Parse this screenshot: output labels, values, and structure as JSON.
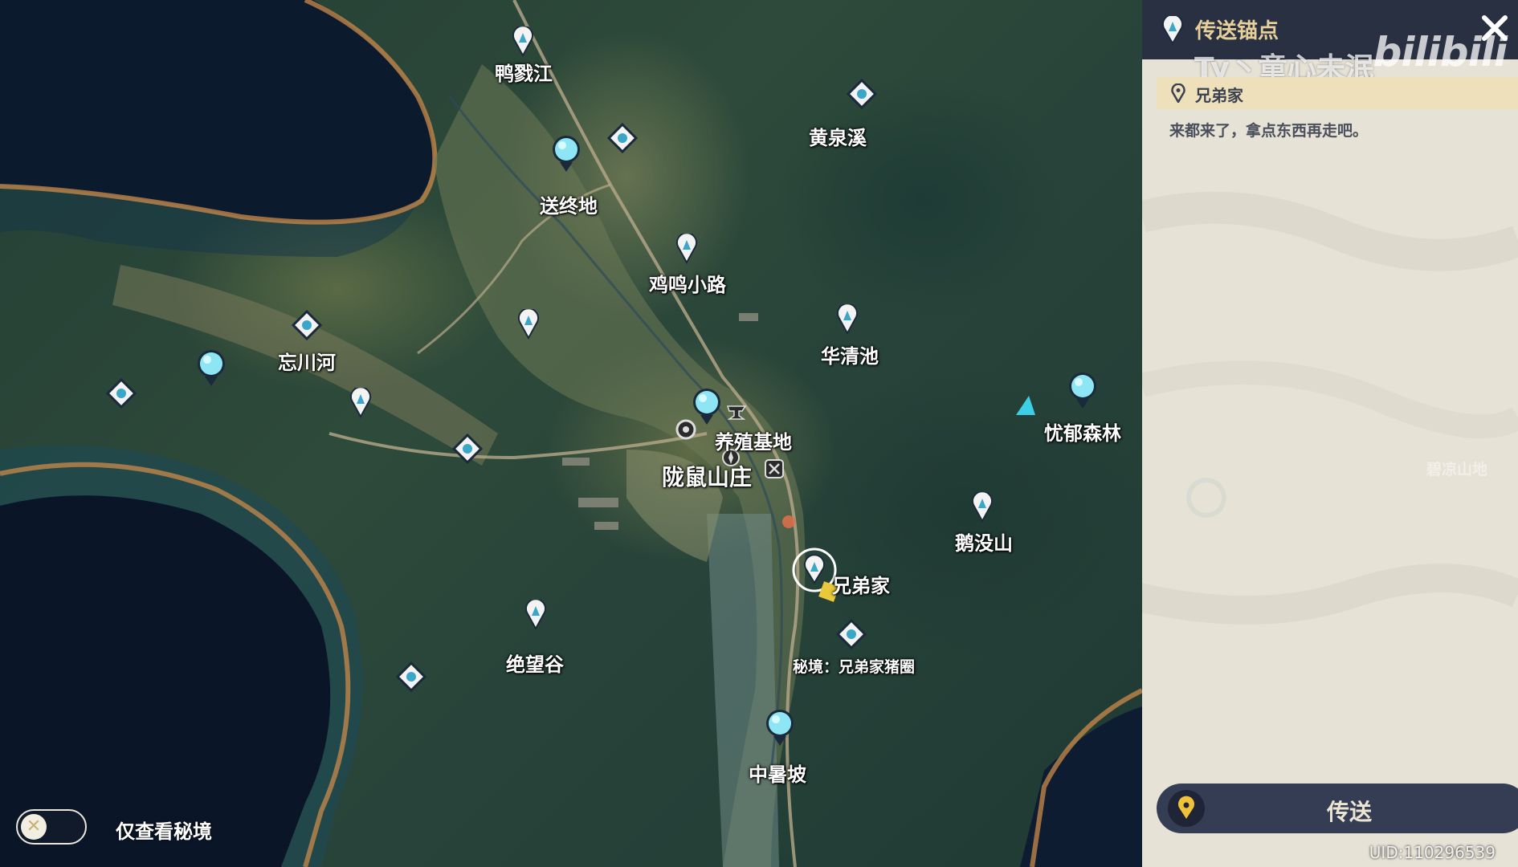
{
  "panel": {
    "title": "传送锚点",
    "location_name": "兄弟家",
    "description": "来都来了，拿点东西再走吧。",
    "teleport_label": "传送"
  },
  "watermark": {
    "user": "Ty丶童心未泯",
    "logo": "bilibili"
  },
  "filter": {
    "label": "仅查看秘境",
    "enabled": false
  },
  "uid": "UID:110296539",
  "places": {
    "yalujiang": "鸭戮江",
    "huangquanxi": "黄泉溪",
    "songzhongdi": "送终地",
    "jimingxiaolu": "鸡鸣小路",
    "wangchuanhe": "忘川河",
    "huaqingchi": "华清池",
    "youyusenlin": "忧郁森林",
    "yangzhijidi": "养殖基地",
    "longshu_shanzhuang": "陇鼠山庄",
    "emoshan": "鹅没山",
    "xiongdijia": "兄弟家",
    "mijing_zhujuan": "秘境：兄弟家猪圈",
    "juewanggu": "绝望谷",
    "zhongshupo": "中暑坡",
    "biliangshandi": "碧凉山地"
  },
  "colors": {
    "accent_gold": "#e6cf98",
    "panel_bg": "#e6e2d6",
    "header_bg": "#283042",
    "water": "#0c1a2e",
    "region_border": "#c98a4a",
    "marker_cyan": "#7fe3f0"
  }
}
